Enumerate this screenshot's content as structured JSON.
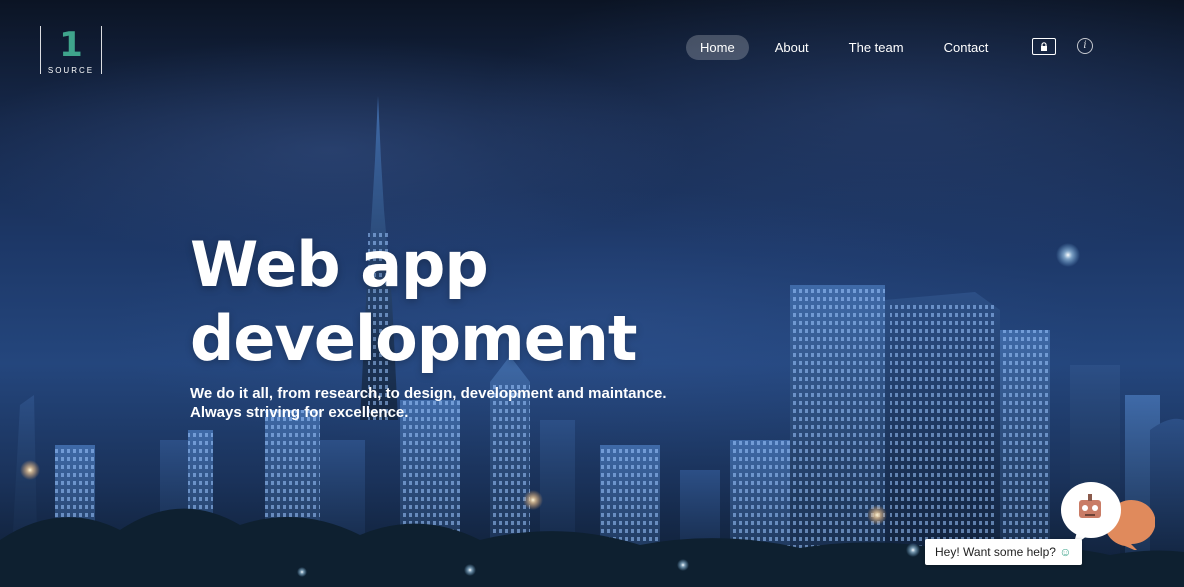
{
  "logo": {
    "number": "1",
    "word": "SOURCE"
  },
  "nav": {
    "items": [
      {
        "label": "Home",
        "active": true
      },
      {
        "label": "About",
        "active": false
      },
      {
        "label": "The team",
        "active": false
      },
      {
        "label": "Contact",
        "active": false
      }
    ],
    "lock_icon": "lock-icon",
    "info_icon": "info-icon",
    "info_glyph": "i"
  },
  "hero": {
    "title_line1": "Web app",
    "title_line2": "development",
    "subtitle_line1": "We do it all, from research, to design, development and maintance.",
    "subtitle_line2": "Always striving for excellence."
  },
  "chat": {
    "prompt": "Hey! Want some help?",
    "smile_glyph": "☺",
    "bot_icon": "robot-icon",
    "accent": "#e08a5c"
  },
  "colors": {
    "brand": "#3fa58c",
    "nav_active_bg": "rgba(255,255,255,0.22)",
    "sky_dark": "#0b1424",
    "sky_mid": "#24467d"
  }
}
